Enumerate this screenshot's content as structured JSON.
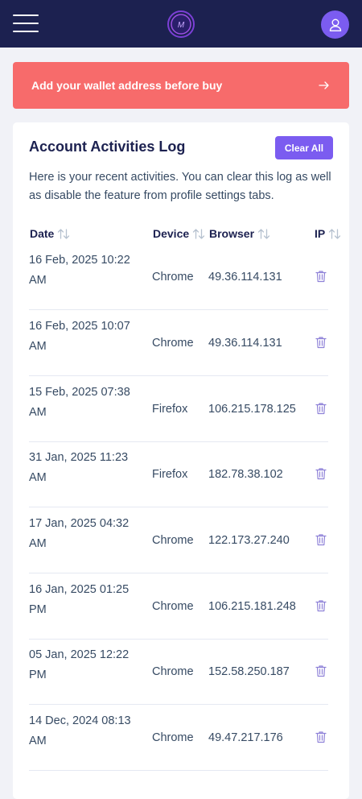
{
  "header": {
    "menu_icon": "hamburger-menu-icon",
    "logo_icon": "brand-logo-icon",
    "user_icon": "user-icon",
    "colors": {
      "bar": "#1c2150",
      "accent": "#7b5cf0"
    }
  },
  "alert": {
    "text": "Add your wallet address before buy",
    "icon": "arrow-right-icon",
    "color": "#f76b6b"
  },
  "activities": {
    "title": "Account Activities Log",
    "clear_label": "Clear All",
    "description": "Here is your recent activities. You can clear this log as well as disable the feature from profile settings tabs.",
    "columns": {
      "date": "Date",
      "device": "Device",
      "browser": "Browser",
      "ip": "IP"
    },
    "rows": [
      {
        "date": "16 Feb, 2025 10:22 AM",
        "device": "Chrome",
        "ip": "49.36.114.131"
      },
      {
        "date": "16 Feb, 2025 10:07 AM",
        "device": "Chrome",
        "ip": "49.36.114.131"
      },
      {
        "date": "15 Feb, 2025 07:38 AM",
        "device": "Firefox",
        "ip": "106.215.178.125"
      },
      {
        "date": "31 Jan, 2025 11:23 AM",
        "device": "Firefox",
        "ip": "182.78.38.102"
      },
      {
        "date": "17 Jan, 2025 04:32 AM",
        "device": "Chrome",
        "ip": "122.173.27.240"
      },
      {
        "date": "16 Jan, 2025 01:25 PM",
        "device": "Chrome",
        "ip": "106.215.181.248"
      },
      {
        "date": "05 Jan, 2025 12:22 PM",
        "device": "Chrome",
        "ip": "152.58.250.187"
      },
      {
        "date": "14 Dec, 2024 08:13 AM",
        "device": "Chrome",
        "ip": "49.47.217.176"
      }
    ]
  }
}
